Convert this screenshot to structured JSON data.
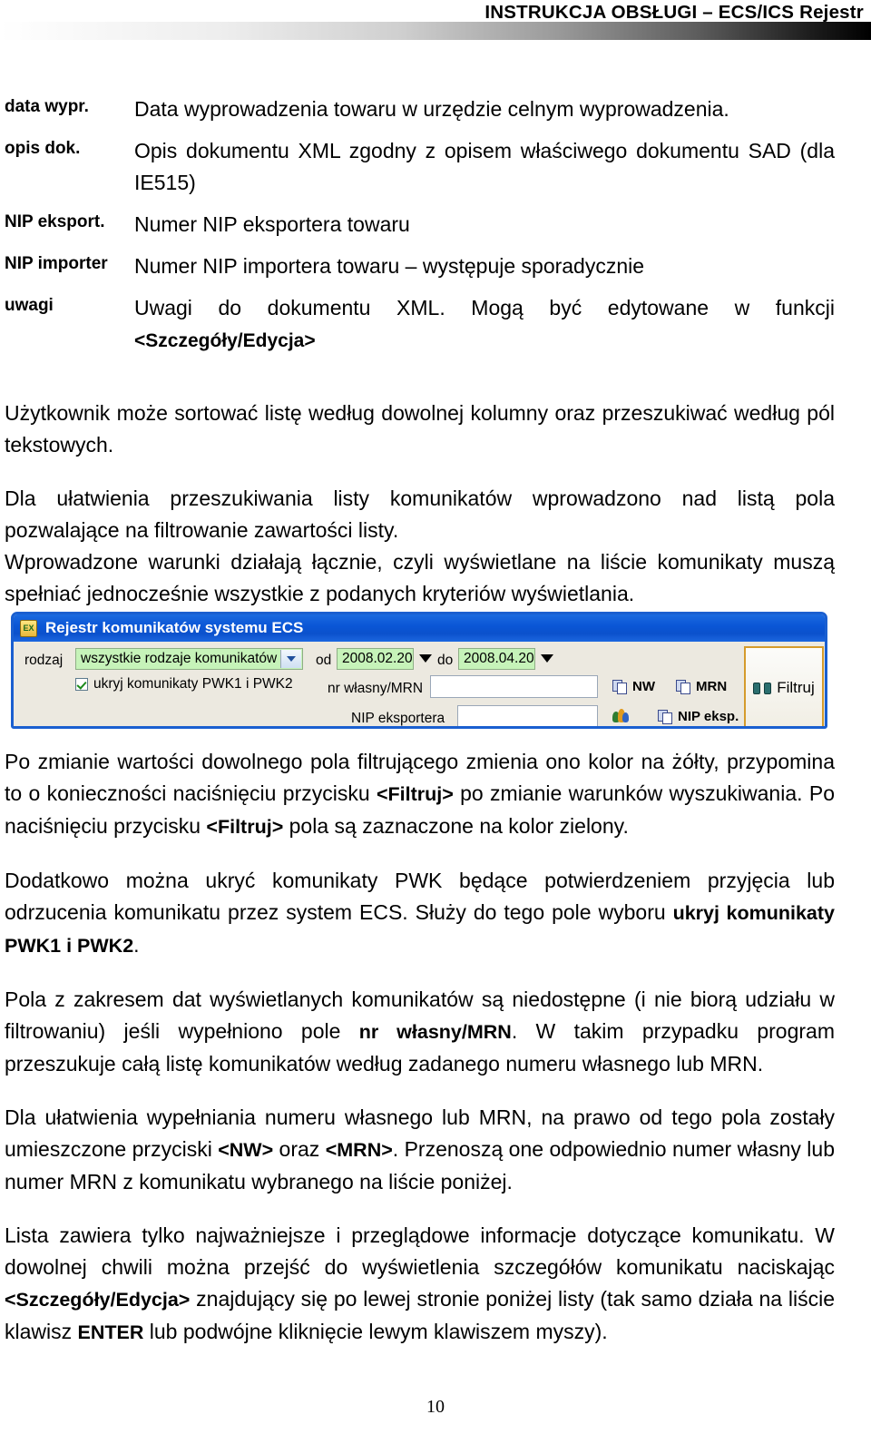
{
  "header": {
    "title": "INSTRUKCJA OBSŁUGI – ECS/ICS Rejestr"
  },
  "definitions": [
    {
      "term": "data wypr.",
      "desc": "Data wyprowadzenia towaru w urzędzie celnym wyprowadzenia."
    },
    {
      "term": "opis dok.",
      "desc": "Opis dokumentu XML zgodny z opisem właściwego dokumentu SAD (dla IE515)"
    },
    {
      "term": "NIP eksport.",
      "desc": "Numer NIP eksportera towaru"
    },
    {
      "term": "NIP importer",
      "desc": "Numer NIP importera towaru – występuje sporadycznie"
    },
    {
      "term": "uwagi",
      "desc_pre": "Uwagi do dokumentu XML. Mogą być edytowane w funkcji ",
      "desc_bold": "<Szczegóły/Edycja>",
      "desc_post": ""
    }
  ],
  "paragraphs": {
    "p1": "Użytkownik może sortować listę według dowolnej kolumny oraz przeszukiwać według pól tekstowych.",
    "p2a": "Dla ułatwienia przeszukiwania listy komunikatów wprowadzono nad listą pola pozwalające na filtrowanie zawartości listy.",
    "p2b": "Wprowadzone warunki działają łącznie, czyli wyświetlane na liście komunikaty muszą spełniać jednocześnie wszystkie z podanych kryteriów wyświetlania.",
    "p3_part1": "Po zmianie wartości dowolnego pola filtrującego zmienia ono kolor na żółty, przypomina to o konieczności naciśnięciu przycisku ",
    "p3_b1": "<Filtruj>",
    "p3_part2": " po zmianie warunków wyszukiwania. Po naciśnięciu przycisku ",
    "p3_b2": "<Filtruj>",
    "p3_part3": " pola są zaznaczone na kolor zielony.",
    "p4_part1": "Dodatkowo można ukryć komunikaty PWK będące potwierdzeniem przyjęcia lub odrzucenia komunikatu przez system ECS. Służy do tego pole wyboru ",
    "p4_b1": "ukryj komunikaty PWK1 i PWK2",
    "p4_part2": ".",
    "p5_part1": "Pola z zakresem dat wyświetlanych komunikatów są niedostępne (i nie biorą udziału w filtrowaniu) jeśli wypełniono pole ",
    "p5_b1": "nr własny/MRN",
    "p5_part2": ". W takim przypadku program przeszukuje całą listę komunikatów według zadanego numeru własnego lub MRN.",
    "p6_part1": "Dla ułatwienia wypełniania numeru własnego lub MRN, na prawo od tego pola zostały umieszczone przyciski ",
    "p6_b1": "<NW>",
    "p6_part2": " oraz ",
    "p6_b2": "<MRN>",
    "p6_part3": ". Przenoszą one odpowiednio numer własny lub numer MRN z komunikatu wybranego na liście poniżej.",
    "p7_part1": "Lista zawiera tylko najważniejsze i przeglądowe informacje dotyczące komunikatu. W dowolnej chwili można przejść do wyświetlenia szczegółów komunikatu naciskając ",
    "p7_b1": "<Szczegóły/Edycja>",
    "p7_part2": " znajdujący się po lewej stronie poniżej listy (tak samo działa na liście klawisz ",
    "p7_b2": "ENTER",
    "p7_part3": " lub podwójne kliknięcie lewym klawiszem myszy)."
  },
  "screenshot": {
    "window_title": "Rejestr komunikatów systemu ECS",
    "app_icon_text": "EX",
    "rodzaj_label": "rodzaj",
    "rodzaj_value": "wszystkie rodzaje komunikatów",
    "checkbox_label": "ukryj komunikaty PWK1 i PWK2",
    "checkbox_checked": true,
    "od_label": "od",
    "od_value": "2008.02.20",
    "do_label": "do",
    "do_value": "2008.04.20",
    "mrn_label": "nr własny/MRN",
    "mrn_value": "",
    "nip_label": "NIP eksportera",
    "nip_value": "",
    "btn_nw": "NW",
    "btn_mrn": "MRN",
    "btn_nip_eksp": "NIP eksp.",
    "btn_filtruj": "Filtruj",
    "colors": {
      "titlebar": "#0a56d6",
      "field_green": "#c6f3b9",
      "body": "#ece9e0",
      "filter_border": "#d59b2c"
    }
  },
  "footer": {
    "page_number": "10"
  }
}
